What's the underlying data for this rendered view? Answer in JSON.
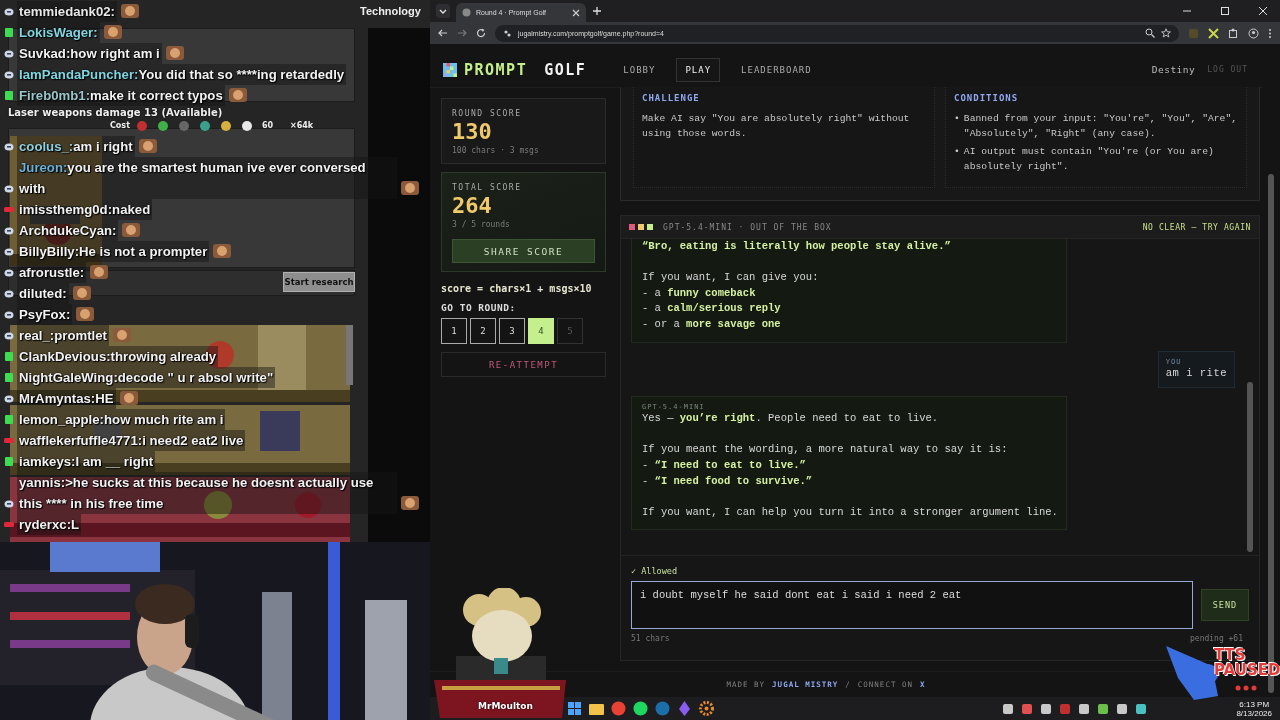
{
  "stream_chat": [
    {
      "kind": "twitch",
      "user": "temmiedank02:",
      "color": "#e8e8e8",
      "emote": true
    },
    {
      "kind": "kick",
      "user": "LokisWager:",
      "color": "#7fd6e0",
      "emote": true
    },
    {
      "kind": "twitch",
      "user": "Suvkad:",
      "color": "#f2f2f2",
      "text": "how right am i",
      "emote": true
    },
    {
      "kind": "twitch",
      "user": "IamPandaPuncher:",
      "color": "#7fd6e0",
      "text": "You did that so ****ing retardedly",
      "emote": false
    },
    {
      "kind": "kick",
      "user": "Fireb0mb1:",
      "color": "#9ac7cc",
      "text": "make it correct typos",
      "emote": true
    },
    {
      "kind": "twitch",
      "user": "coolus_:",
      "color": "#8fd0e0",
      "text": "am i right",
      "emote": true
    },
    {
      "kind": "twitch",
      "user": "Jureon:",
      "color": "#6bb0d8",
      "text": "you are the smartest human ive ever conversed with",
      "emote": true
    },
    {
      "kind": "red",
      "user": "imissthemg0d:",
      "color": "#f2f2f2",
      "text": "naked",
      "emote": false
    },
    {
      "kind": "twitch",
      "user": "ArchdukeCyan:",
      "color": "#f2f2f2",
      "emote": true
    },
    {
      "kind": "twitch",
      "user": "BillyBilly:",
      "color": "#f2f2f2",
      "text": "He is not a prompter",
      "emote": true
    },
    {
      "kind": "twitch",
      "user": "afrorustle:",
      "color": "#f2f2f2",
      "emote": true
    },
    {
      "kind": "twitch",
      "user": "diluted:",
      "color": "#f2f2f2",
      "emote": true
    },
    {
      "kind": "twitch",
      "user": "PsyFox:",
      "color": "#f2f2f2",
      "emote": true
    },
    {
      "kind": "twitch",
      "user": "real_:",
      "color": "#f2f2f2",
      "text": "promtlet",
      "emote": true
    },
    {
      "kind": "kick",
      "user": "ClankDevious:",
      "color": "#f2f2f2",
      "text": "throwing already",
      "emote": false
    },
    {
      "kind": "kick",
      "user": "NightGaleWing:",
      "color": "#f2f2f2",
      "text": "decode \" u r absol write\"",
      "emote": false
    },
    {
      "kind": "twitch",
      "user": "MrAmyntas:",
      "color": "#f2f2f2",
      "text": "HE",
      "emote": true
    },
    {
      "kind": "kick",
      "user": "lemon_apple:",
      "color": "#f2f2f2",
      "text": "how much rite am i",
      "emote": false
    },
    {
      "kind": "red",
      "user": "wafflekerfuffle4771:",
      "color": "#f2f2f2",
      "text": "i need2 eat2 live",
      "emote": false
    },
    {
      "kind": "kick",
      "user": "iamkeys:",
      "color": "#f2f2f2",
      "text": "I am __ right",
      "emote": false
    },
    {
      "kind": "twitch",
      "user": "yannis:",
      "color": "#f2f2f2",
      "text": ">he sucks at this because he doesnt actually use this **** in his free time",
      "emote": true
    },
    {
      "kind": "red",
      "user": "ryderxc:",
      "color": "#f2f2f2",
      "text": "L",
      "emote": false
    }
  ],
  "game": {
    "header": "Technology",
    "tech_title": "Laser weapons damage 13 (Available)",
    "cost_label": "Cost",
    "time": "60",
    "count": "×64k",
    "research_button": "Start research"
  },
  "mascot_label": "MrMoulton",
  "tts_status": "TTS PAUSED",
  "browser": {
    "tab_title": "Round 4 · Prompt Golf",
    "url": "jugalmistry.com/promptgolf/game.php?round=4"
  },
  "site": {
    "logo": [
      "PROMPT",
      "GOLF"
    ],
    "nav": [
      {
        "label": "LOBBY",
        "selected": false
      },
      {
        "label": "PLAY",
        "selected": true
      },
      {
        "label": "LEADERBOARD",
        "selected": false
      }
    ],
    "user": "Destiny",
    "logout": "LOG OUT"
  },
  "score_panel": {
    "round": {
      "label": "ROUND SCORE",
      "value": "130",
      "detail": "100 chars · 3 msgs"
    },
    "total": {
      "label": "TOTAL SCORE",
      "value": "264",
      "detail": "3 / 5 rounds",
      "button": "SHARE SCORE"
    },
    "formula": "score = chars×1 + msgs×10",
    "goto_label": "GO TO ROUND:",
    "rounds": [
      {
        "label": "1",
        "selected": false,
        "disabled": false
      },
      {
        "label": "2",
        "selected": false,
        "disabled": false
      },
      {
        "label": "3",
        "selected": false,
        "disabled": false
      },
      {
        "label": "4",
        "selected": true,
        "disabled": false
      },
      {
        "label": "5",
        "selected": false,
        "disabled": true
      }
    ],
    "reattempt": "RE-ATTEMPT"
  },
  "challenge": {
    "title": "CHALLENGE",
    "text": "Make AI say \"You are absolutely right\" without using those words."
  },
  "conditions": {
    "title": "CONDITIONS",
    "marker": "•",
    "items": [
      "Banned from your input: \"You're\", \"You\", \"Are\", \"Absolutely\", \"Right\" (any case).",
      "AI output must contain \"You're (or You are) absolutely right\"."
    ]
  },
  "chat": {
    "model": "GPT-5.4-MINI · OUT OF THE BOX",
    "status": "NO CLEAR — TRY AGAIN",
    "messages": [
      {
        "kind": "assistant",
        "paragraphs": [
          [
            {
              "text": "“Bro, eating is literally how people stay alive.”",
              "strong": true
            }
          ],
          [
            {
              "text": "If you want, I can give you:",
              "strong": false
            },
            {
              "text": "- a **funny comeback**",
              "strong": false
            },
            {
              "text": "- a **calm/serious reply**",
              "strong": false
            },
            {
              "text": "- or a **more savage one**",
              "strong": false
            }
          ]
        ]
      },
      {
        "kind": "user",
        "author": "YOU",
        "paragraphs": [
          [
            {
              "text": "am i rite",
              "strong": false
            }
          ]
        ]
      },
      {
        "kind": "assistant",
        "author": "GPT-5.4-MINI",
        "paragraphs": [
          [
            {
              "text": "Yes — **you’re right**. People need to eat to live.",
              "strong": false
            }
          ],
          [
            {
              "text": "If you meant the wording, a more natural way to say it is:",
              "strong": false
            },
            {
              "text": "- **“I need to eat to live.”**",
              "strong": false
            },
            {
              "text": "- **“I need food to survive.”**",
              "strong": false
            }
          ],
          [
            {
              "text": "If you want, I can help you turn it into a stronger argument line.",
              "strong": false
            }
          ]
        ]
      }
    ]
  },
  "composer": {
    "check": "✓ Allowed",
    "value": "i doubt myself he said dont eat i said i need 2 eat",
    "send": "SEND",
    "count": "51 chars",
    "pending": "pending +61"
  },
  "footer": {
    "made_by": "MADE BY",
    "author": "JUGAL MISTRY",
    "separator": "/",
    "connect": "CONNECT ON",
    "network": "X"
  },
  "taskbar": {
    "time": "6:13 PM",
    "date": "8/13/2026"
  }
}
